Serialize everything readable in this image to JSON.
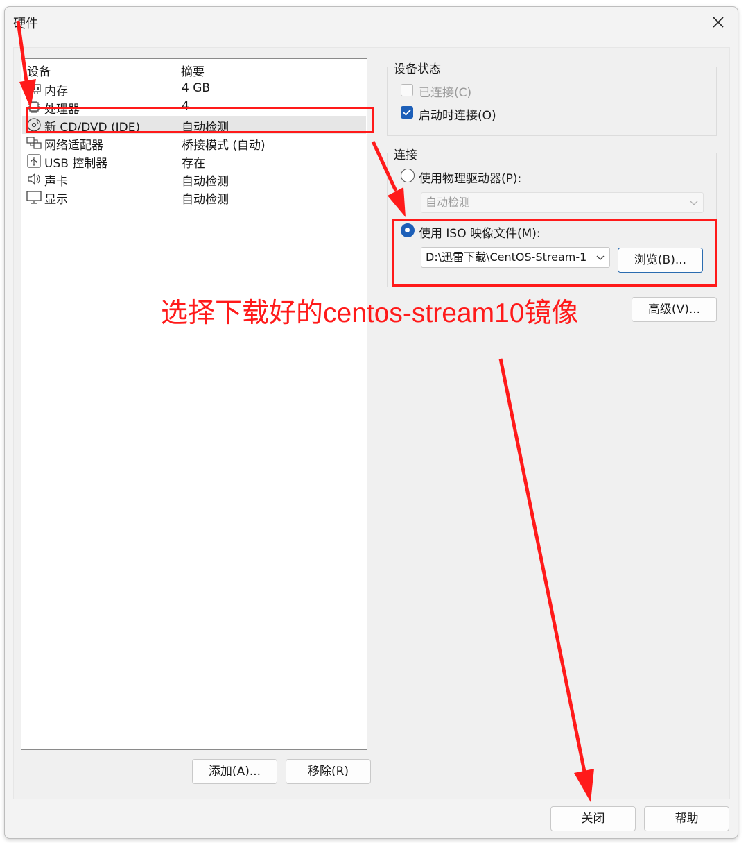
{
  "window": {
    "title": "硬件"
  },
  "device_list": {
    "headers": {
      "device": "设备",
      "summary": "摘要"
    },
    "rows": [
      {
        "name": "内存",
        "summary": "4 GB",
        "icon": "memory-icon"
      },
      {
        "name": "处理器",
        "summary": "4",
        "icon": "processor-icon"
      },
      {
        "name": "新 CD/DVD (IDE)",
        "summary": "自动检测",
        "icon": "cd-dvd-icon"
      },
      {
        "name": "网络适配器",
        "summary": "桥接模式 (自动)",
        "icon": "network-adapter-icon"
      },
      {
        "name": "USB 控制器",
        "summary": "存在",
        "icon": "usb-icon"
      },
      {
        "name": "声卡",
        "summary": "自动检测",
        "icon": "speaker-icon"
      },
      {
        "name": "显示",
        "summary": "自动检测",
        "icon": "monitor-icon"
      }
    ],
    "add_label": "添加(A)...",
    "remove_label": "移除(R)"
  },
  "device_status": {
    "title": "设备状态",
    "connected_label": "已连接(C)",
    "connected": false,
    "connect_at_power_on_label": "启动时连接(O)",
    "connect_at_power_on": true
  },
  "connection": {
    "title": "连接",
    "physical_drive_label": "使用物理驱动器(P):",
    "physical_drive_value": "自动检测",
    "iso_label": "使用 ISO 映像文件(M):",
    "iso_path": "D:\\迅雷下载\\CentOS-Stream-1",
    "browse_label": "浏览(B)...",
    "selected": "iso"
  },
  "advanced_label": "高级(V)...",
  "footer": {
    "close_label": "关闭",
    "help_label": "帮助"
  },
  "annotation": {
    "text": "选择下载好的centos-stream10镜像"
  },
  "colors": {
    "accent": "#1d5fb8",
    "annotation": "#ff1a1a"
  }
}
